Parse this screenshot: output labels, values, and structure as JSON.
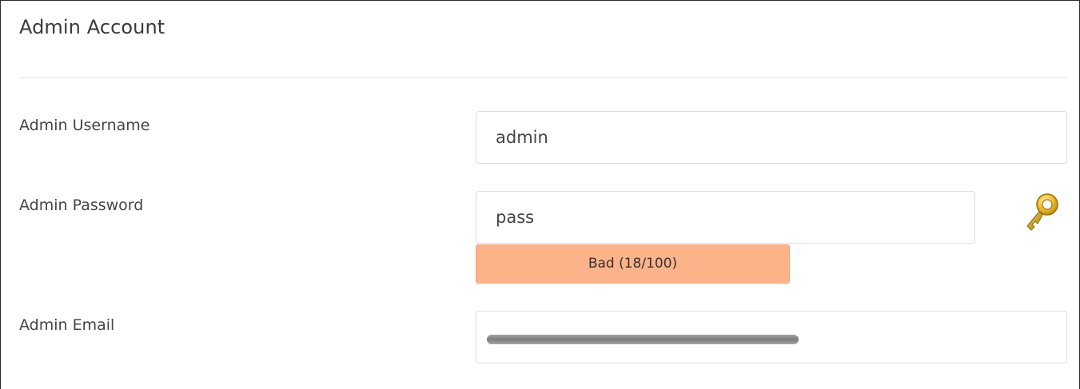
{
  "section": {
    "title": "Admin Account"
  },
  "fields": {
    "username": {
      "label": "Admin Username",
      "value": "admin"
    },
    "password": {
      "label": "Admin Password",
      "value": "pass",
      "strength_label": "Bad (18/100)",
      "strength_score": 18,
      "strength_color": "#fdb38a",
      "generate_icon": "key-icon"
    },
    "email": {
      "label": "Admin Email",
      "value": ""
    }
  }
}
